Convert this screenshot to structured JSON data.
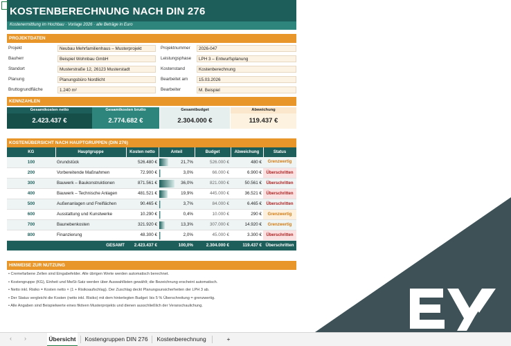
{
  "title": "KOSTENBERECHNUNG NACH DIN 276",
  "subtitle": "Kostenermittlung im Hochbau · Vorlage 2026 · alle Beträge in Euro",
  "project": {
    "header": "PROJEKTDATEN",
    "left": [
      {
        "label": "Projekt",
        "value": "Neubau Mehrfamilienhaus – Musterprojekt"
      },
      {
        "label": "Bauherr",
        "value": "Beispiel Wohnbau GmbH"
      },
      {
        "label": "Standort",
        "value": "Musterstraße 12, 26123 Musterstadt"
      },
      {
        "label": "Planung",
        "value": "Planungsbüro Nordlicht"
      },
      {
        "label": "Bruttogrundfläche",
        "value": "1.240 m²"
      }
    ],
    "right": [
      {
        "label": "Projektnummer",
        "value": "2026-047"
      },
      {
        "label": "Leistungsphase",
        "value": "LPH 3 – Entwurfsplanung"
      },
      {
        "label": "Kostenstand",
        "value": "Kostenberechnung"
      },
      {
        "label": "Bearbeitet am",
        "value": "15.03.2026"
      },
      {
        "label": "Bearbeiter",
        "value": "M. Beispiel"
      }
    ]
  },
  "kpis": {
    "header": "KENNZAHLEN",
    "items": [
      {
        "label": "Gesamtkosten netto",
        "value": "2.423.437 €",
        "head_bg": "#1e5e5a",
        "head_fg": "#ffffff",
        "val_bg": "#164e4a",
        "val_fg": "#ffffff"
      },
      {
        "label": "Gesamtkosten brutto",
        "value": "2.774.682 €",
        "head_bg": "#2e857c",
        "head_fg": "#ffffff",
        "val_bg": "#2e857c",
        "val_fg": "#ffffff"
      },
      {
        "label": "Gesamtbudget",
        "value": "2.304.000 €",
        "head_bg": "#e6efee",
        "head_fg": "#222222",
        "val_bg": "#e6efee",
        "val_fg": "#222222"
      },
      {
        "label": "Abweichung",
        "value": "119.437 €",
        "head_bg": "#fbe8cc",
        "head_fg": "#222222",
        "val_bg": "#fdf1df",
        "val_fg": "#222222"
      }
    ]
  },
  "table": {
    "header": "KOSTENÜBERSICHT NACH HAUPTGRUPPEN (DIN 276)",
    "columns": [
      "KG",
      "Hauptgruppe",
      "Kosten netto",
      "Anteil",
      "Budget",
      "Abweichung",
      "Status"
    ],
    "rows": [
      {
        "kg": "100",
        "group": "Grundstück",
        "cost": "526.480 €",
        "share": "21,7%",
        "share_pct": 21.7,
        "budget": "526.000 €",
        "dev": "480 €",
        "status": "Grenzwertig",
        "level": "warn"
      },
      {
        "kg": "200",
        "group": "Vorbereitende Maßnahmen",
        "cost": "72.900 €",
        "share": "3,0%",
        "share_pct": 3.0,
        "budget": "66.000 €",
        "dev": "6.900 €",
        "status": "Überschritten",
        "level": "over"
      },
      {
        "kg": "300",
        "group": "Bauwerk – Baukonstruktionen",
        "cost": "871.561 €",
        "share": "36,0%",
        "share_pct": 36.0,
        "budget": "821.000 €",
        "dev": "50.561 €",
        "status": "Überschritten",
        "level": "over"
      },
      {
        "kg": "400",
        "group": "Bauwerk – Technische Anlagen",
        "cost": "481.521 €",
        "share": "19,9%",
        "share_pct": 19.9,
        "budget": "445.000 €",
        "dev": "36.521 €",
        "status": "Überschritten",
        "level": "over"
      },
      {
        "kg": "500",
        "group": "Außenanlagen und Freiflächen",
        "cost": "90.465 €",
        "share": "3,7%",
        "share_pct": 3.7,
        "budget": "84.000 €",
        "dev": "6.465 €",
        "status": "Überschritten",
        "level": "over"
      },
      {
        "kg": "600",
        "group": "Ausstattung und Kunstwerke",
        "cost": "10.290 €",
        "share": "0,4%",
        "share_pct": 0.4,
        "budget": "10.000 €",
        "dev": "290 €",
        "status": "Grenzwertig",
        "level": "warn"
      },
      {
        "kg": "700",
        "group": "Baunebenkosten",
        "cost": "321.920 €",
        "share": "13,3%",
        "share_pct": 13.3,
        "budget": "307.000 €",
        "dev": "14.920 €",
        "status": "Grenzwertig",
        "level": "warn"
      },
      {
        "kg": "800",
        "group": "Finanzierung",
        "cost": "48.300 €",
        "share": "2,0%",
        "share_pct": 2.0,
        "budget": "45.000 €",
        "dev": "3.300 €",
        "status": "Überschritten",
        "level": "over"
      }
    ],
    "total": {
      "label": "GESAMT",
      "cost": "2.423.437 €",
      "share": "100,0%",
      "budget": "2.304.000 €",
      "dev": "119.437 €",
      "status": "Überschritten"
    }
  },
  "notes": {
    "header": "HINWEISE ZUR NUTZUNG",
    "items": [
      "• Cremefarbene Zellen sind Eingabefelder. Alle übrigen Werte werden automatisch berechnet.",
      "• Kostengruppe (KG), Einheit und MwSt-Satz werden über Auswahllisten gewählt; die Bezeichnung erscheint automatisch.",
      "• Netto inkl. Risiko = Kosten netto × (1 + Risikoaufschlag). Der Zuschlag deckt Planungsunsicherheiten der LPH 3 ab.",
      "• Der Status vergleicht die Kosten (netto inkl. Risiko) mit dem hinterlegten Budget: bis 5 % Überschreitung = grenzwertig.",
      "• Alle Angaben sind Beispielwerte eines fiktiven Musterprojekts und dienen ausschließlich der Veranschaulichung."
    ]
  },
  "tabs": [
    "Übersicht",
    "Kostengruppen DIN 276",
    "Kostenberechnung"
  ],
  "add_tab": "+",
  "nav_prev": "‹",
  "nav_next": "›",
  "colors": {
    "teal_dark": "#1e5e5a",
    "teal": "#2e857c",
    "orange": "#e8962a",
    "overlay": "#3d5156"
  }
}
